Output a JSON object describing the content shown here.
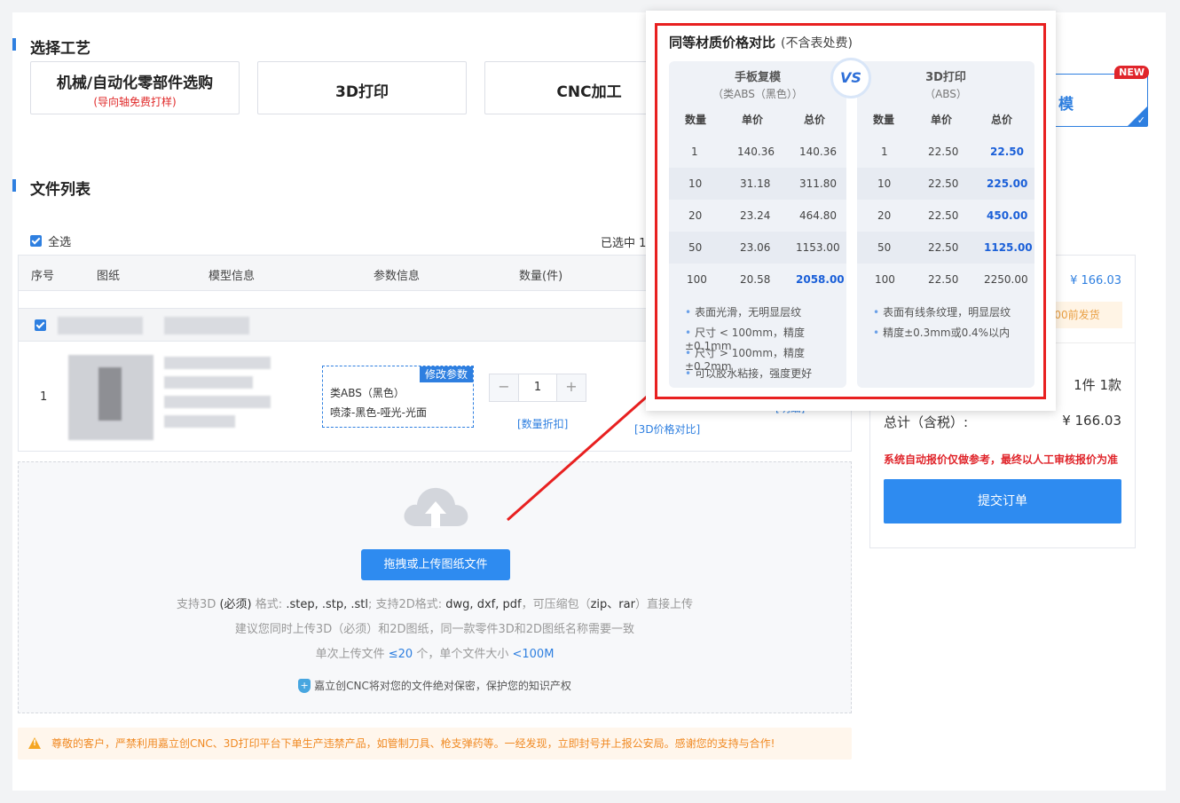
{
  "section_process": "选择工艺",
  "processes": [
    {
      "title": "机械/自动化零部件选购",
      "sub": "(导向轴免费打样)"
    },
    {
      "title": "3D打印"
    },
    {
      "title": "CNC加工"
    },
    {
      "title": "手板复模",
      "visible": "模",
      "badge": "NEW"
    }
  ],
  "section_files": "文件列表",
  "select_all": "全选",
  "selected_text": "已选中 1",
  "table_headers": [
    "序号",
    "图纸",
    "模型信息",
    "参数信息",
    "数量(件)"
  ],
  "row": {
    "index": "1",
    "param_tag": "修改参数",
    "param_material": "类ABS（黑色）",
    "param_finish": "喷漆-黑色-哑光-光面",
    "qty": "1",
    "qty_discount": "[数量折扣]",
    "price_compare": "[3D价格对比]",
    "detail": "[明细]"
  },
  "upload": {
    "button": "拖拽或上传图纸文件",
    "line1_a": "支持3D",
    "line1_b": "(必须)",
    "line1_c": "格式:",
    "line1_d": ".step, .stp, .stl",
    "line1_e": "; 支持2D格式:",
    "line1_f": "dwg, dxf, pdf",
    "line1_g": "，可压缩包（",
    "line1_h": "zip、rar",
    "line1_i": "）直接上传",
    "line2": "建议您同时上传3D（必须）和2D图纸，同一款零件3D和2D图纸名称需要一致",
    "line3_a": "单次上传文件",
    "line3_b": "≤20",
    "line3_c": "个，单个文件大小",
    "line3_d": "<100M",
    "security": "嘉立创CNC将对您的文件绝对保密，保护您的知识产权"
  },
  "warning": "尊敬的客户，严禁利用嘉立创CNC、3D打印平台下单生产违禁产品，如管制刀具、枪支弹药等。一经发现，立即封号并上报公安局。感谢您的支持与合作!",
  "summary": {
    "price_top": "¥ 166.03",
    "ship_note": "23:00前发货",
    "count": "1件  1款",
    "total_label": "总计（含税）:",
    "total_value": "¥ 166.03",
    "disclaimer": "系统自动报价仅做参考，最终以人工审核报价为准",
    "submit": "提交订单"
  },
  "popup": {
    "title": "同等材质价格对比",
    "title_note": "(不含表处费)",
    "vs": "VS",
    "left": {
      "name": "手板复模",
      "material": "（类ABS（黑色））",
      "headers": [
        "数量",
        "单价",
        "总价"
      ],
      "rows": [
        [
          "1",
          "140.36",
          "140.36"
        ],
        [
          "10",
          "31.18",
          "311.80"
        ],
        [
          "20",
          "23.24",
          "464.80"
        ],
        [
          "50",
          "23.06",
          "1153.00"
        ],
        [
          "100",
          "20.58",
          "2058.00"
        ]
      ],
      "notes": [
        "表面光滑，无明显层纹",
        "尺寸 < 100mm，精度±0.1mm",
        "尺寸 > 100mm，精度±0.2mm",
        "可以胶水粘接，强度更好"
      ]
    },
    "right": {
      "name": "3D打印",
      "material": "（ABS）",
      "headers": [
        "数量",
        "单价",
        "总价"
      ],
      "rows": [
        [
          "1",
          "22.50",
          "22.50"
        ],
        [
          "10",
          "22.50",
          "225.00"
        ],
        [
          "20",
          "22.50",
          "450.00"
        ],
        [
          "50",
          "22.50",
          "1125.00"
        ],
        [
          "100",
          "22.50",
          "2250.00"
        ]
      ],
      "notes": [
        "表面有线条纹理，明显层纹",
        "精度±0.3mm或0.4%以内"
      ]
    }
  }
}
